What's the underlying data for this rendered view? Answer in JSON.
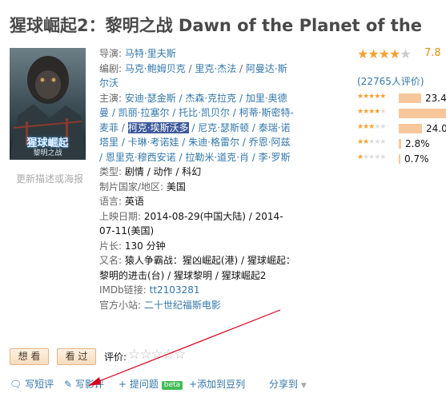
{
  "title": "猩球崛起2：黎明之战 Dawn of the Planet of the",
  "poster": {
    "line1": "猩球崛起",
    "line2": "黎明之战"
  },
  "update_link": "更新描述或海报",
  "info": {
    "director_label": "导演:",
    "director": "马特·里夫斯",
    "writer_label": "编剧:",
    "writer_a": "马克·鲍姆贝克",
    "writer_b": "里克·杰法",
    "writer_c": "阿曼达·斯尔沃",
    "cast_label": "主演:",
    "cast_a": "安迪·瑟金斯 / 杰森·克拉克 / 加里·奥德曼 / 凯丽·拉塞尔 / 托比·凯贝尔 / 柯蒂·斯密特-麦菲 /",
    "cast_sel": "柯克·埃斯沃多",
    "cast_b": "/ 尼克·瑟斯顿 / 泰瑞·诺塔里 / 卡琳·考诺娃 / 朱迪·格雷尔 / 乔恩·阿兹 / 恩里克·穆西安诺 / 拉勒米·道克·肖 / 李·罗斯",
    "genre_label": "类型:",
    "genre": "剧情 / 动作 / 科幻",
    "country_label": "制片国家/地区:",
    "country": "美国",
    "language_label": "语言:",
    "language": "英语",
    "release_label": "上映日期:",
    "release": "2014-08-29(中国大陆) / 2014-07-11(美国)",
    "runtime_label": "片长:",
    "runtime": "130 分钟",
    "aka_label": "又名:",
    "aka": "猿人争霸战：猩凶崛起(港) / 猩球崛起：黎明的进击(台) / 猩球黎明 / 猩球崛起2",
    "imdb_label": "IMDb链接:",
    "imdb": "tt2103281",
    "site_label": "官方小站:",
    "site": "二十世纪福斯电影"
  },
  "rating": {
    "score": "7.8",
    "stars": 4,
    "count": "(22765人评价)",
    "distribution": [
      {
        "stars": 5,
        "pct": "23.4",
        "fraction": 0.234
      },
      {
        "stars": 4,
        "pct": "",
        "fraction": 0.49
      },
      {
        "stars": 3,
        "pct": "24.0",
        "fraction": 0.24
      },
      {
        "stars": 2,
        "pct": "2.8%",
        "fraction": 0.028
      },
      {
        "stars": 1,
        "pct": "0.7%",
        "fraction": 0.007
      }
    ]
  },
  "buttons": {
    "want": "想 看",
    "seen": "看 过",
    "rate_label": "评价:"
  },
  "actions": {
    "short_review": "写短评",
    "review": "写影评",
    "question": "提问题",
    "beta": "beta",
    "add_list": "添加到豆列",
    "share": "分享到"
  },
  "colors": {
    "link": "#3377aa",
    "star": "#f7a033",
    "bar": "#f7c79b",
    "arrow": "#d9001b"
  }
}
